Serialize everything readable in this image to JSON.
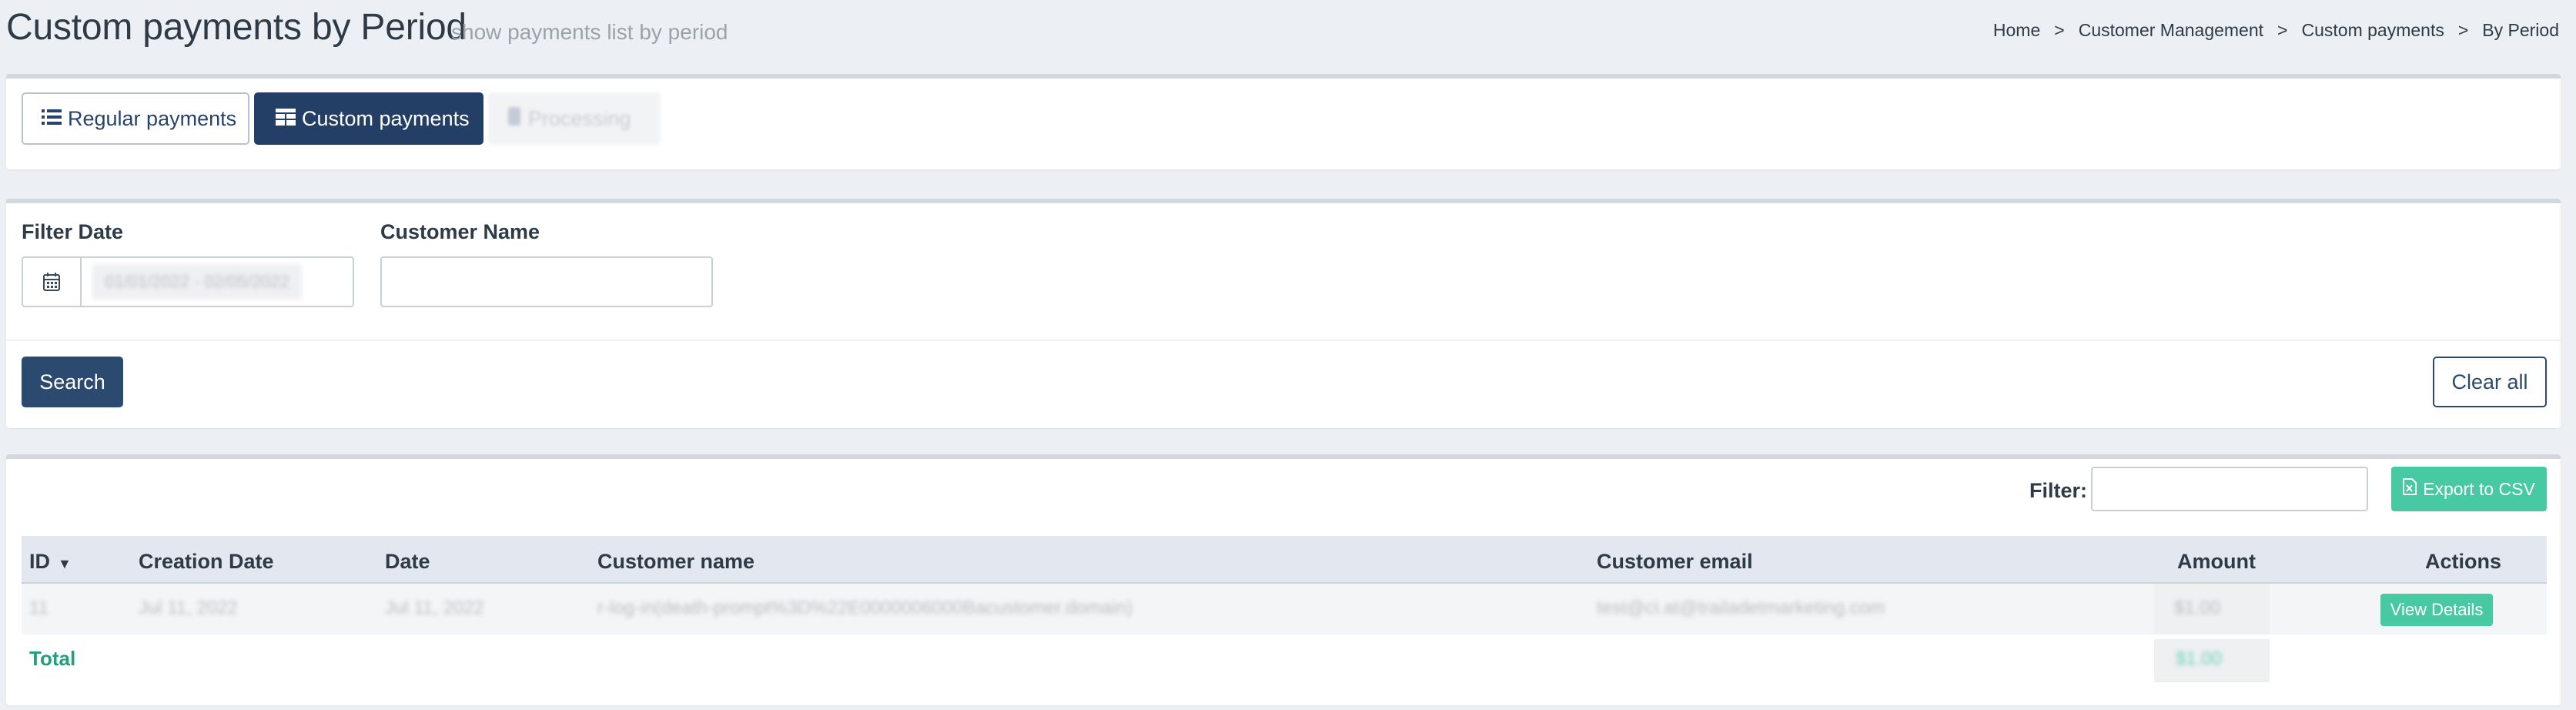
{
  "header": {
    "title": "Custom payments by Period",
    "subtitle": "show payments list by period",
    "breadcrumb": [
      "Home",
      "Customer Management",
      "Custom payments",
      "By Period"
    ],
    "breadcrumb_sep": ">"
  },
  "tabs": {
    "regular": "Regular payments",
    "custom": "Custom payments",
    "processing": "Processing"
  },
  "filters": {
    "date_label": "Filter Date",
    "date_value": "01/01/2022 - 02/05/2022",
    "name_label": "Customer Name",
    "name_value": "",
    "search": "Search",
    "clear": "Clear all"
  },
  "table_tools": {
    "filter_label": "Filter:",
    "export": "Export to CSV"
  },
  "table": {
    "columns": [
      "ID",
      "Creation Date",
      "Date",
      "Customer name",
      "Customer email",
      "Amount",
      "Actions"
    ],
    "rows": [
      {
        "id": "11",
        "creation_date": "Jul 11, 2022",
        "date": "Jul 11, 2022",
        "customer_name": "r-log-in(death-prompt%3D%22E0000006000Bacustomer.domain)",
        "customer_email": "test@ci.at@trailadetmarketing.com",
        "amount": "$1.00",
        "action": "View Details"
      }
    ],
    "total_label": "Total",
    "total_value": "$1.00"
  },
  "colors": {
    "primary": "#243f66",
    "accent": "#47c9a3",
    "total": "#23a07a"
  }
}
